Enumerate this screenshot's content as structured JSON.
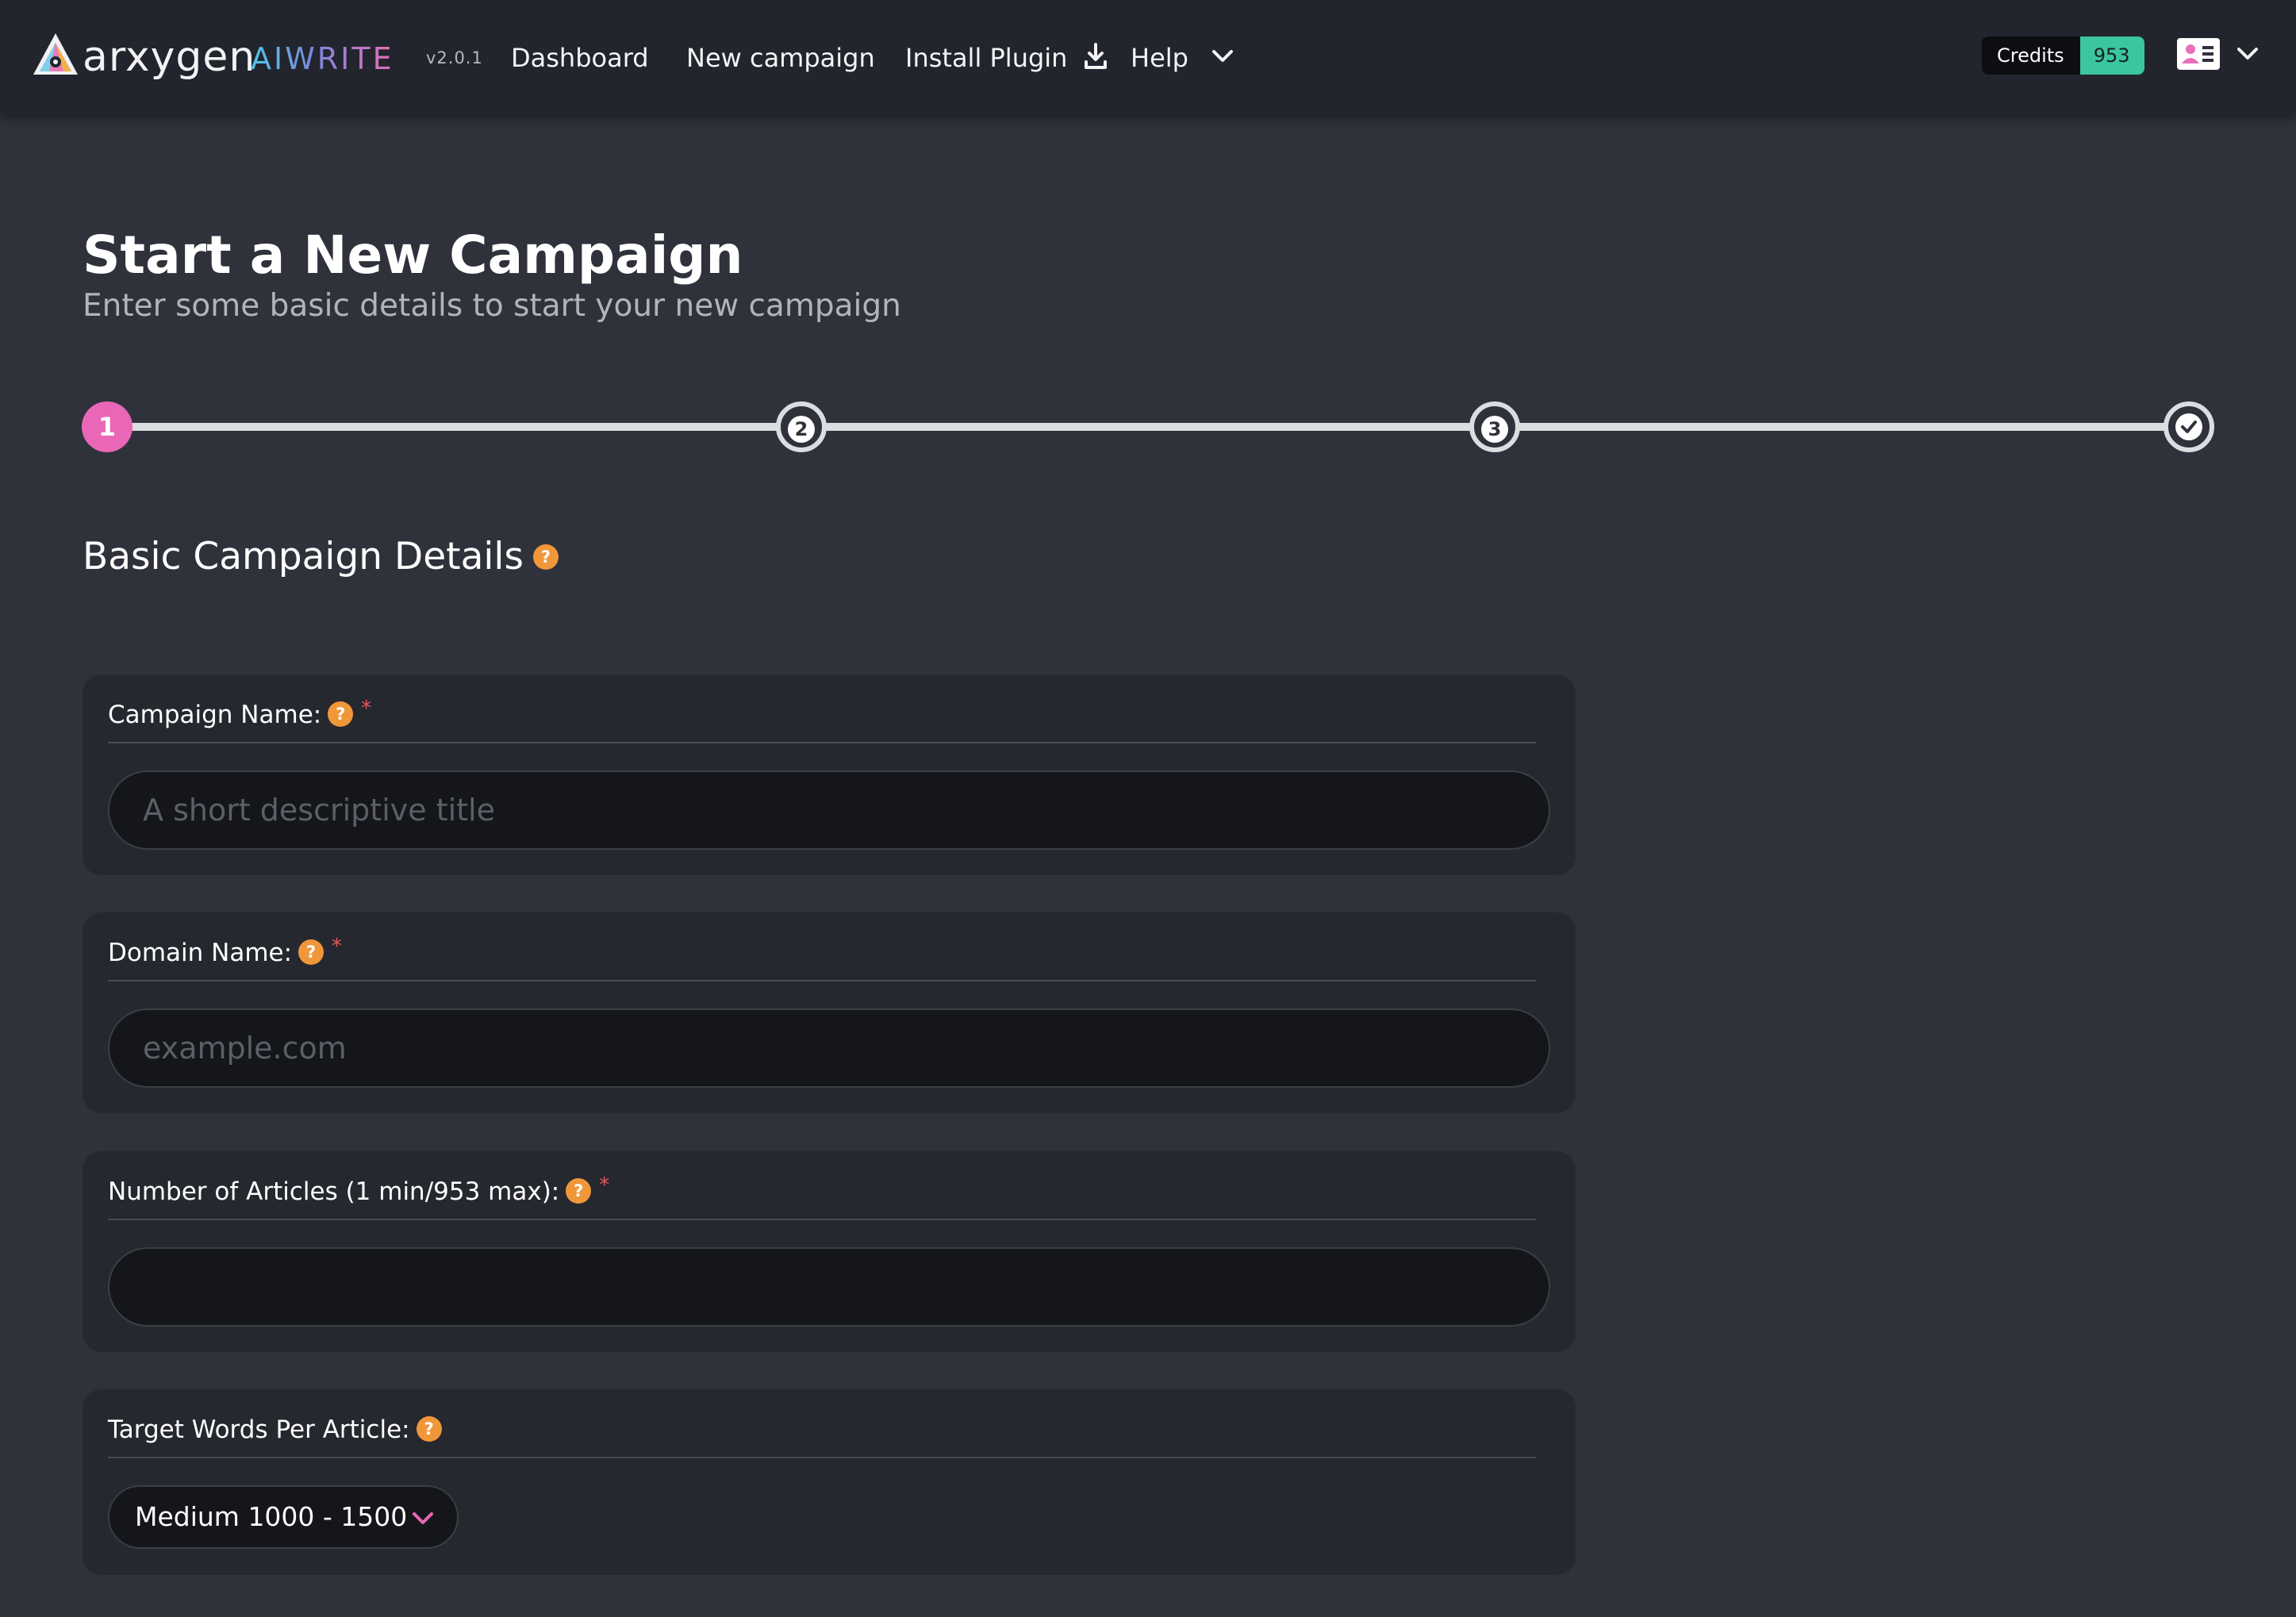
{
  "app": {
    "brand": "arxygen",
    "product": "AIWRITE",
    "version": "v2.0.1"
  },
  "nav": {
    "dashboard": "Dashboard",
    "new_campaign": "New campaign",
    "install_plugin": "Install Plugin",
    "help": "Help"
  },
  "credits": {
    "label": "Credits",
    "value": "953"
  },
  "page": {
    "title": "Start a New Campaign",
    "subtitle": "Enter some basic details to start your new campaign"
  },
  "stepper": {
    "steps": [
      {
        "label": "1",
        "state": "active"
      },
      {
        "label": "2",
        "state": "pending"
      },
      {
        "label": "3",
        "state": "pending"
      },
      {
        "label": "done",
        "state": "pending"
      }
    ]
  },
  "section": {
    "title": "Basic Campaign Details"
  },
  "form": {
    "campaign_name": {
      "label": "Campaign Name:",
      "placeholder": "A short descriptive title",
      "value": "",
      "required": true
    },
    "domain_name": {
      "label": "Domain Name:",
      "placeholder": "example.com",
      "value": "",
      "required": true
    },
    "num_articles": {
      "label": "Number of Articles (1 min/953 max):",
      "placeholder": "",
      "value": "",
      "required": true
    },
    "target_words": {
      "label": "Target Words Per Article:",
      "selected": "Medium 1000 - 1500"
    }
  },
  "help_glyph": "?",
  "required_glyph": "*",
  "icons": {
    "plugin": "download-icon",
    "help": "chevron-down-icon",
    "user": "user-card-icon",
    "step_done": "check-icon"
  },
  "colors": {
    "accent_pink": "#ea67b7",
    "credits_green": "#3cc5a1",
    "help_orange": "#f0973a",
    "required_red": "#e25858",
    "background": "#2f323b",
    "topbar": "#22252d",
    "card": "#262830"
  }
}
